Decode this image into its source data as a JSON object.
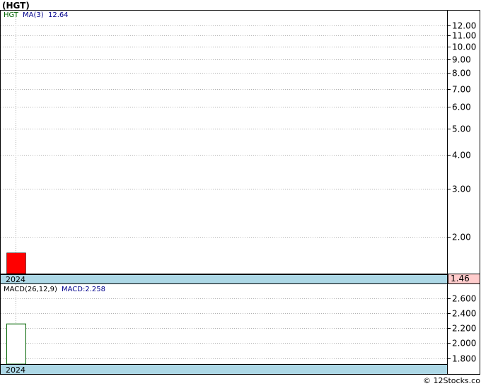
{
  "title": "(HGT)",
  "credit": "© 12Stocks.com",
  "colors": {
    "panel_border": "#000000",
    "grid": "#b0b0b0",
    "date_strip": "#add8e6",
    "price_bar": "#ff0000",
    "macd_bar_fill": "#ffffff",
    "macd_bar_stroke": "#006400",
    "ticker_label": "#006400",
    "ma_label": "#00008b",
    "last_price_box": "#ffcccc"
  },
  "chart_data": [
    {
      "type": "bar",
      "panel": "price",
      "scale": "log",
      "legend": {
        "ticker": "HGT",
        "indicator": "MA(3)",
        "indicator_value": "12.64"
      },
      "ylim": [
        1.46,
        13.6
      ],
      "yticks": [
        "12.00",
        "11.00",
        "10.00",
        "9.00",
        "8.00",
        "7.00",
        "6.00",
        "5.00",
        "4.00",
        "3.00",
        "2.00"
      ],
      "x": [
        "2024"
      ],
      "bars": [
        {
          "open": 1.74,
          "close": 1.46
        }
      ],
      "last_price": "1.46",
      "date_label": "2024"
    },
    {
      "type": "bar",
      "panel": "macd",
      "legend": {
        "indicator": "MACD(26,12,9)",
        "value": "MACD:2.258"
      },
      "ylim": [
        1.72,
        2.79
      ],
      "yticks": [
        "2.600",
        "2.400",
        "2.200",
        "2.000",
        "1.800"
      ],
      "x": [
        "2024"
      ],
      "values": [
        2.258
      ],
      "date_label": "2024"
    }
  ]
}
